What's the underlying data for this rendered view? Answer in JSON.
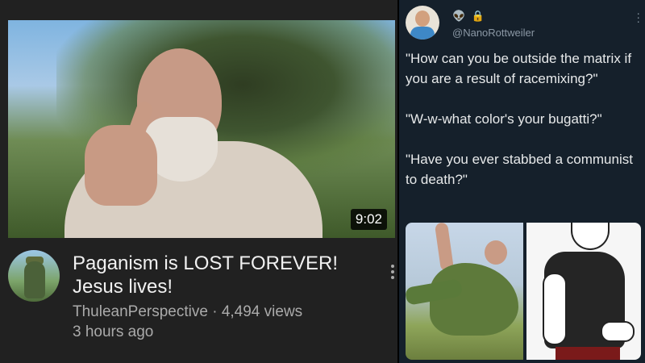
{
  "youtube": {
    "duration": "9:02",
    "video_title": "Paganism is LOST FOREVER! Jesus lives!",
    "channel_name": "ThuleanPerspective",
    "separator": "·",
    "views": "4,494 views",
    "posted": "3 hours ago"
  },
  "tweet": {
    "handle": "@NanoRottweiler",
    "icons": [
      "alien-icon",
      "lock-icon"
    ],
    "paragraphs": [
      "\"How can you be outside the matrix if you are a result of racemixing?\"",
      "\"W-w-what color's your bugatti?\"",
      "\"Have you ever stabbed a communist to death?\""
    ]
  },
  "colors": {
    "yt_background": "#212121",
    "tw_background": "#15202b",
    "title_text": "#f1f1f1",
    "secondary_text": "#aaaaaa",
    "tw_text": "#e7e9ea",
    "tw_secondary": "#8b98a5"
  }
}
